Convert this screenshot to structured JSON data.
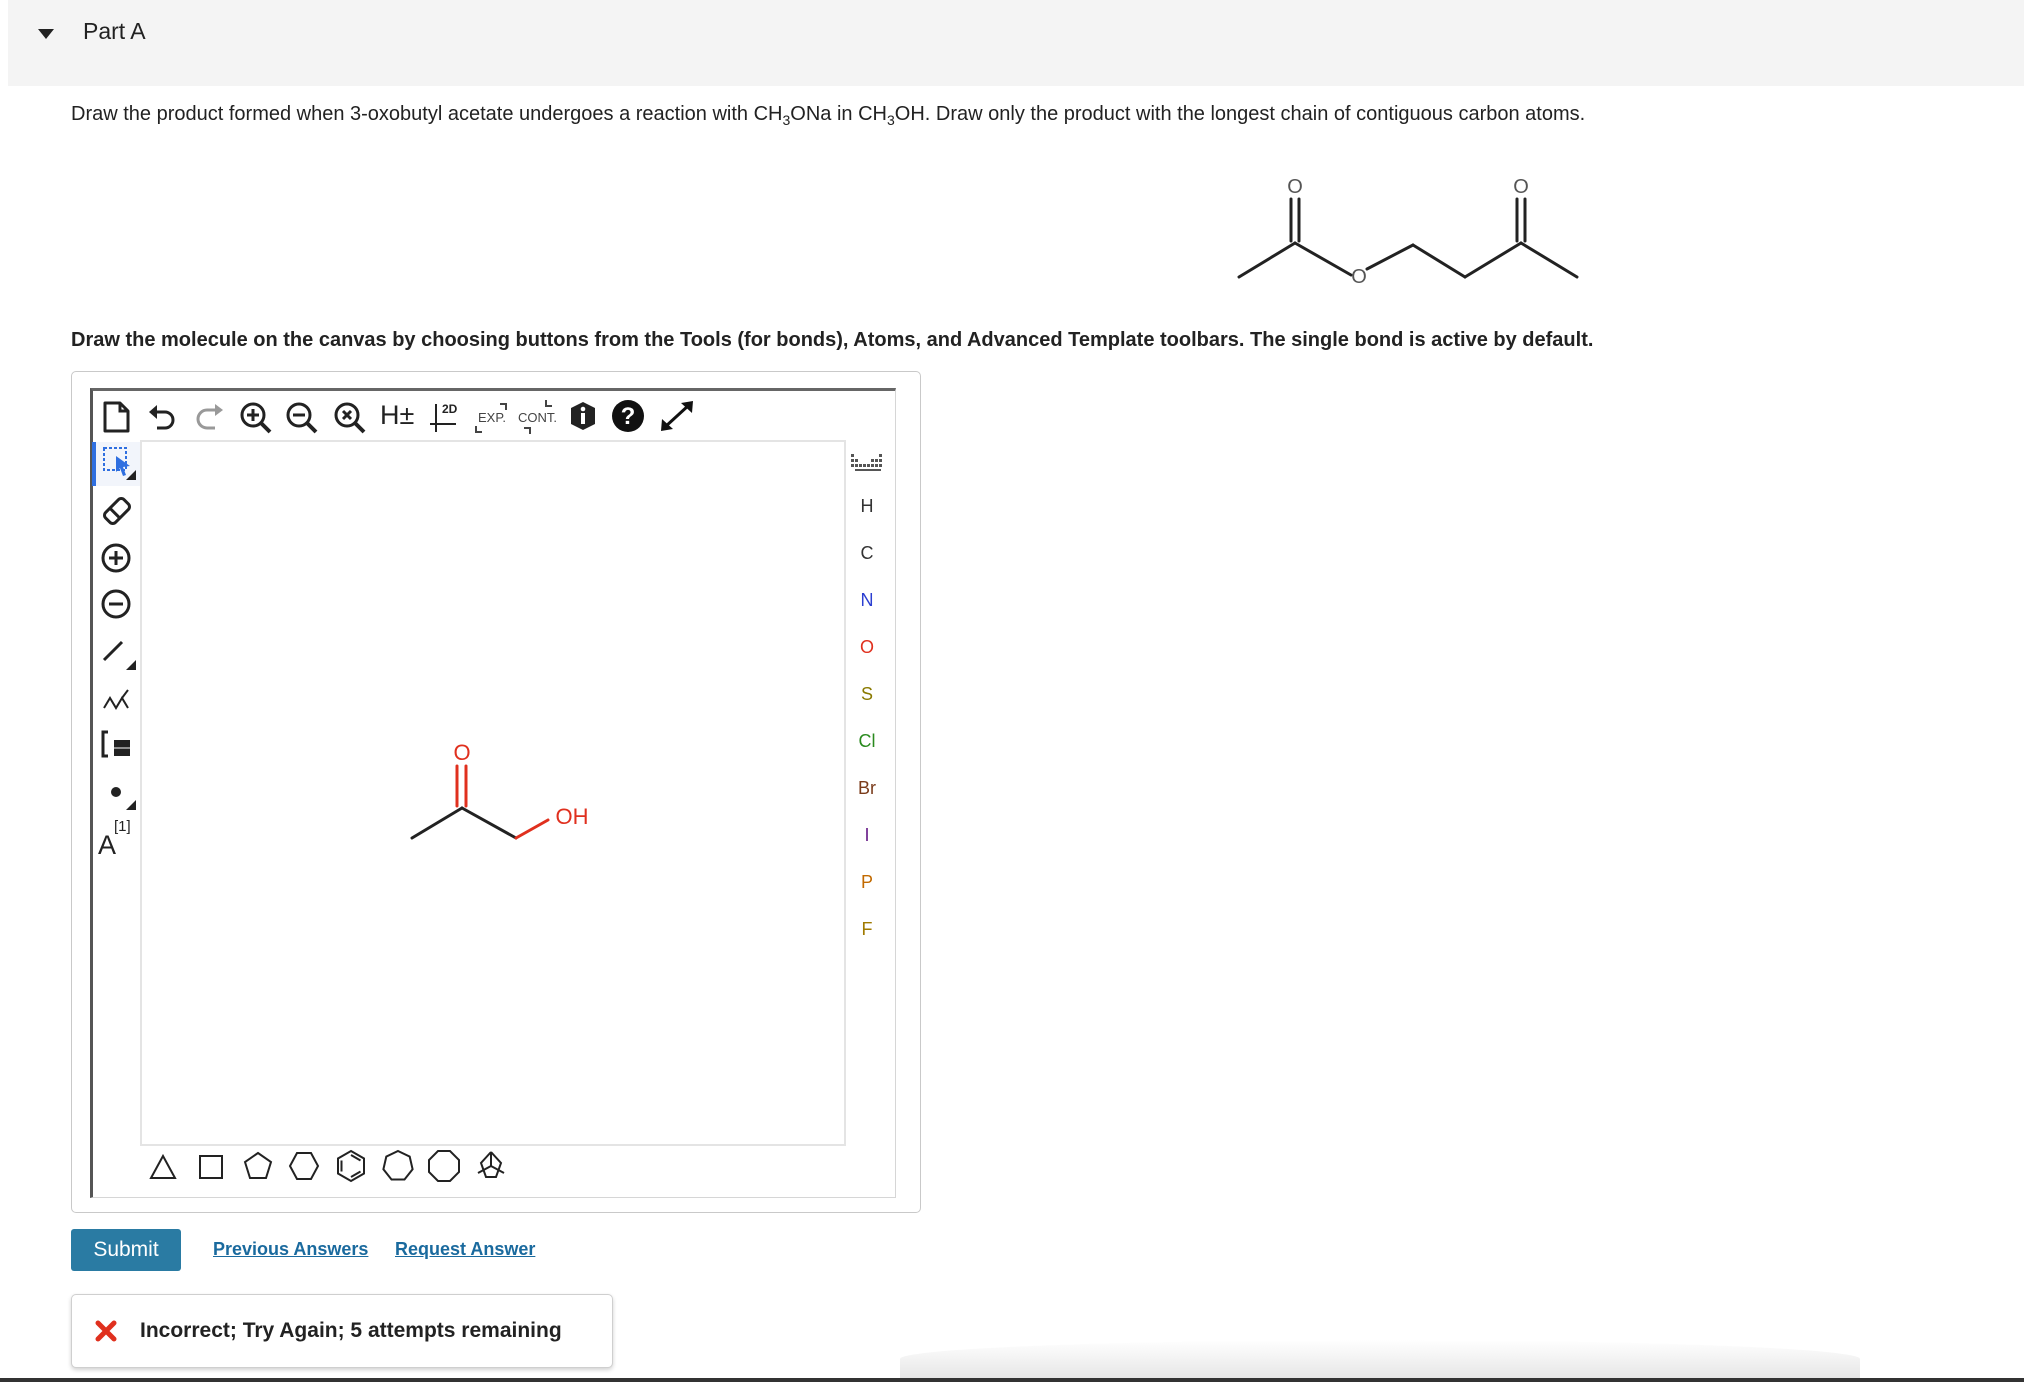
{
  "part": {
    "title": "Part A"
  },
  "question": {
    "before_sub1": "Draw the product formed when 3-oxobutyl acetate undergoes a reaction with CH",
    "sub1": "3",
    "between": "ONa in CH",
    "sub2": "3",
    "after_sub2": "OH. Draw only the product with the longest chain of contiguous carbon atoms."
  },
  "reference_molecule": {
    "oxygen_labels": [
      "O",
      "O",
      "O"
    ]
  },
  "instructions": "Draw the molecule on the canvas by choosing buttons from the Tools (for bonds), Atoms, and Advanced Template toolbars. The single bond is active by default.",
  "toolbar": {
    "hydrogen_label": "H±",
    "twoD_label": "2D",
    "expand_label": "EXP.",
    "contract_label": "CONT."
  },
  "left_tools": {
    "charge_label_text": "A",
    "charge_label_index": "[1]"
  },
  "atoms": [
    "H",
    "C",
    "N",
    "O",
    "S",
    "Cl",
    "Br",
    "I",
    "P",
    "F"
  ],
  "atom_colors": {
    "H": "#333333",
    "C": "#333333",
    "N": "#2c3fd1",
    "O": "#e0301e",
    "S": "#8a7a00",
    "Cl": "#2a8a1e",
    "Br": "#7a3b1a",
    "I": "#6a1f8a",
    "P": "#c26a00",
    "F": "#a07a00"
  },
  "canvas_molecule": {
    "oxygen_label": "O",
    "hydroxyl_label": "OH"
  },
  "templates": [
    "triangle",
    "square",
    "pentagon",
    "hexagon",
    "benzene",
    "heptagon",
    "octagon",
    "bicyclic"
  ],
  "actions": {
    "submit": "Submit",
    "previous_answers": "Previous Answers",
    "request_answer": "Request Answer"
  },
  "feedback": {
    "message": "Incorrect; Try Again; 5 attempts remaining"
  },
  "colors": {
    "submit_bg": "#2a7ba3",
    "link": "#1a6a9e",
    "error_red": "#e0301e",
    "selected_tool": "#2f6fe0"
  }
}
